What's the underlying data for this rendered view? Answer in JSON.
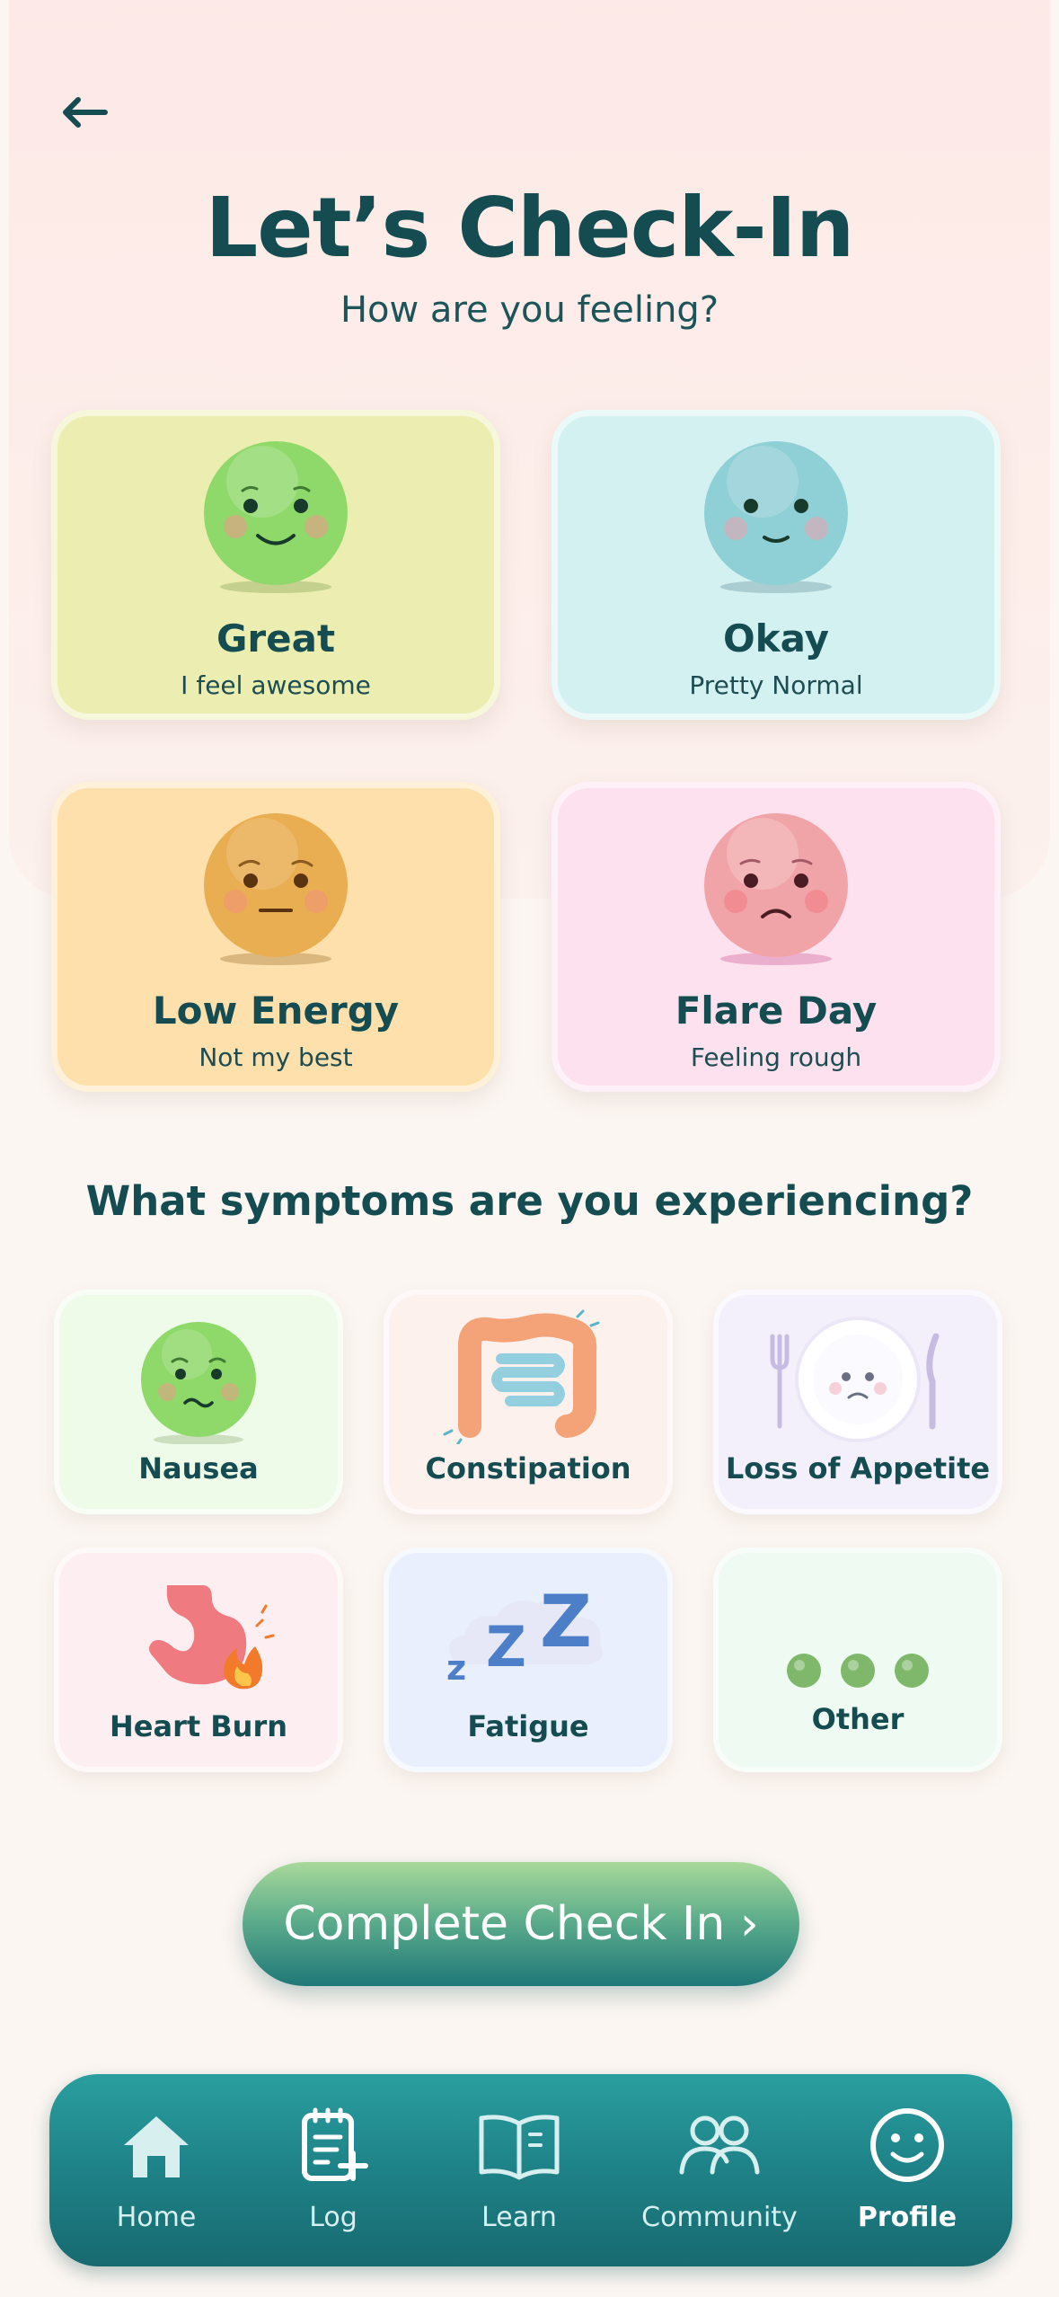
{
  "header": {
    "back_icon": "arrow-left-icon",
    "title": "Let’s Check-In",
    "subtitle": "How are you feeling?"
  },
  "moods": [
    {
      "label": "Great",
      "desc": "I feel awesome",
      "icon": "smiling-face-icon",
      "bg": "#ebeeb0",
      "face": "#8fd86a"
    },
    {
      "label": "Okay",
      "desc": "Pretty Normal",
      "icon": "neutral-smile-face-icon",
      "bg": "#d4f1f2",
      "face": "#8fcfd6"
    },
    {
      "label": "Low Energy",
      "desc": "Not my best",
      "icon": "tired-face-icon",
      "bg": "#fde0ac",
      "face": "#e9ad52"
    },
    {
      "label": "Flare Day",
      "desc": "Feeling rough",
      "icon": "sad-face-icon",
      "bg": "#fde1ee",
      "face": "#f1a4a8"
    }
  ],
  "symptoms_title": "What symptoms are you experiencing?",
  "symptoms": [
    {
      "label": "Nausea",
      "icon": "queasy-face-icon",
      "bg": "#eefbe8"
    },
    {
      "label": "Constipation",
      "icon": "intestine-icon",
      "bg": "#fdf1ee"
    },
    {
      "label": "Loss of Appetite",
      "icon": "empty-plate-icon",
      "bg": "#f3f0fb"
    },
    {
      "label": "Heart Burn",
      "icon": "burning-stomach-icon",
      "bg": "#fdeff1"
    },
    {
      "label": "Fatigue",
      "icon": "sleep-zzz-icon",
      "bg": "#e9effc"
    },
    {
      "label": "Other",
      "icon": "more-dots-icon",
      "bg": "#eefaf2"
    }
  ],
  "cta_label": "Complete Check In ›",
  "nav": [
    {
      "label": "Home",
      "icon": "home-icon"
    },
    {
      "label": "Log",
      "icon": "clipboard-add-icon",
      "active": true
    },
    {
      "label": "Learn",
      "icon": "book-icon"
    },
    {
      "label": "Community",
      "icon": "people-icon"
    },
    {
      "label": "Profile",
      "icon": "smiley-profile-icon"
    }
  ]
}
